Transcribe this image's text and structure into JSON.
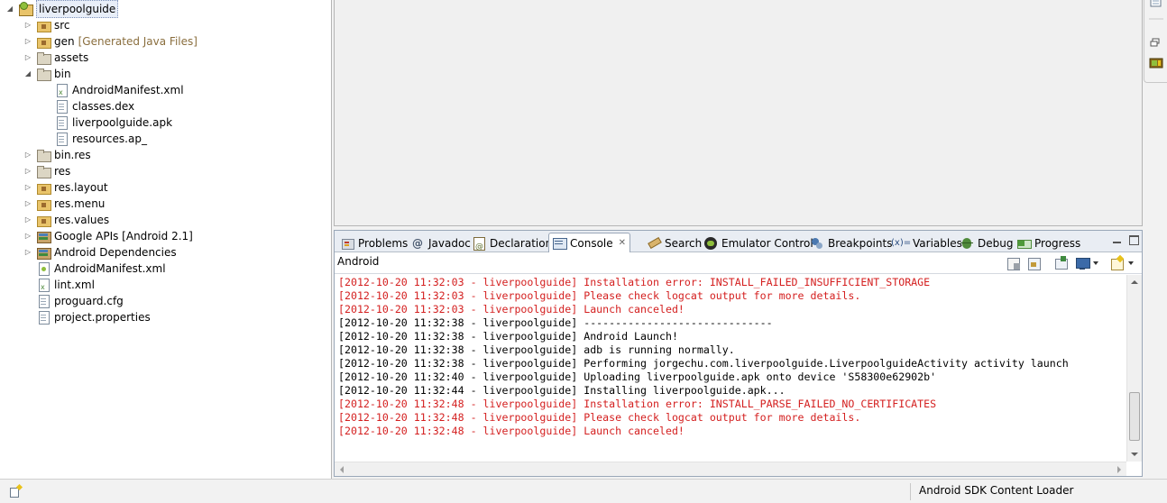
{
  "explorer": {
    "items": [
      {
        "label": "liverpoolguide",
        "decoration": "",
        "icon": "android-project-icon",
        "twisty": "expanded",
        "depth": 0
      },
      {
        "label": "src",
        "decoration": "",
        "icon": "source-folder-icon",
        "twisty": "collapsed",
        "depth": 1
      },
      {
        "label": "gen",
        "decoration": "[Generated Java Files]",
        "icon": "source-folder-icon",
        "twisty": "collapsed",
        "depth": 1
      },
      {
        "label": "assets",
        "decoration": "",
        "icon": "folder-icon",
        "twisty": "collapsed",
        "depth": 1
      },
      {
        "label": "bin",
        "decoration": "",
        "icon": "folder-icon",
        "twisty": "expanded",
        "depth": 1
      },
      {
        "label": "AndroidManifest.xml",
        "decoration": "",
        "icon": "xml-file-icon",
        "twisty": "none",
        "depth": 2
      },
      {
        "label": "classes.dex",
        "decoration": "",
        "icon": "file-icon",
        "twisty": "none",
        "depth": 2
      },
      {
        "label": "liverpoolguide.apk",
        "decoration": "",
        "icon": "file-icon",
        "twisty": "none",
        "depth": 2
      },
      {
        "label": "resources.ap_",
        "decoration": "",
        "icon": "file-icon",
        "twisty": "none",
        "depth": 2
      },
      {
        "label": "bin.res",
        "decoration": "",
        "icon": "folder-icon",
        "twisty": "collapsed",
        "depth": 1
      },
      {
        "label": "res",
        "decoration": "",
        "icon": "folder-icon",
        "twisty": "collapsed",
        "depth": 1
      },
      {
        "label": "res.layout",
        "decoration": "",
        "icon": "package-folder-icon",
        "twisty": "collapsed",
        "depth": 1
      },
      {
        "label": "res.menu",
        "decoration": "",
        "icon": "package-folder-icon",
        "twisty": "collapsed",
        "depth": 1
      },
      {
        "label": "res.values",
        "decoration": "",
        "icon": "package-folder-icon",
        "twisty": "collapsed",
        "depth": 1
      },
      {
        "label": "Google APIs [Android 2.1]",
        "decoration": "",
        "icon": "library-icon",
        "twisty": "collapsed",
        "depth": 1
      },
      {
        "label": "Android Dependencies",
        "decoration": "",
        "icon": "library-icon",
        "twisty": "collapsed",
        "depth": 1
      },
      {
        "label": "AndroidManifest.xml",
        "decoration": "",
        "icon": "android-manifest-icon",
        "twisty": "none",
        "depth": 1
      },
      {
        "label": "lint.xml",
        "decoration": "",
        "icon": "xml-file-icon",
        "twisty": "none",
        "depth": 1
      },
      {
        "label": "proguard.cfg",
        "decoration": "",
        "icon": "file-icon",
        "twisty": "none",
        "depth": 1
      },
      {
        "label": "project.properties",
        "decoration": "",
        "icon": "file-icon",
        "twisty": "none",
        "depth": 1
      }
    ]
  },
  "panel": {
    "tabs": [
      {
        "label": "Problems",
        "icon": "problems-icon",
        "active": false
      },
      {
        "label": "Javadoc",
        "icon": "javadoc-icon",
        "active": false
      },
      {
        "label": "Declaration",
        "icon": "declaration-icon",
        "active": false
      },
      {
        "label": "Console",
        "icon": "console-icon",
        "active": true
      },
      {
        "label": "Search",
        "icon": "search-icon",
        "active": false
      },
      {
        "label": "Emulator Control",
        "icon": "emulator-icon",
        "active": false
      },
      {
        "label": "Breakpoints",
        "icon": "breakpoints-icon",
        "active": false
      },
      {
        "label": "Variables",
        "icon": "variables-icon",
        "active": false
      },
      {
        "label": "Debug",
        "icon": "debug-icon",
        "active": false
      },
      {
        "label": "Progress",
        "icon": "progress-icon",
        "active": false
      }
    ],
    "variables_glyph": "(x)=",
    "javadoc_glyph": "@",
    "console_title": "Android",
    "console_lines": [
      {
        "text": "[2012-10-20 11:32:03 - liverpoolguide] Installation error: INSTALL_FAILED_INSUFFICIENT_STORAGE",
        "level": "error"
      },
      {
        "text": "[2012-10-20 11:32:03 - liverpoolguide] Please check logcat output for more details.",
        "level": "error"
      },
      {
        "text": "[2012-10-20 11:32:03 - liverpoolguide] Launch canceled!",
        "level": "error"
      },
      {
        "text": "[2012-10-20 11:32:38 - liverpoolguide] ------------------------------",
        "level": "info"
      },
      {
        "text": "[2012-10-20 11:32:38 - liverpoolguide] Android Launch!",
        "level": "info"
      },
      {
        "text": "[2012-10-20 11:32:38 - liverpoolguide] adb is running normally.",
        "level": "info"
      },
      {
        "text": "[2012-10-20 11:32:38 - liverpoolguide] Performing jorgechu.com.liverpoolguide.LiverpoolguideActivity activity launch",
        "level": "info"
      },
      {
        "text": "[2012-10-20 11:32:40 - liverpoolguide] Uploading liverpoolguide.apk onto device 'S58300e62902b'",
        "level": "info"
      },
      {
        "text": "[2012-10-20 11:32:44 - liverpoolguide] Installing liverpoolguide.apk...",
        "level": "info"
      },
      {
        "text": "[2012-10-20 11:32:48 - liverpoolguide] Installation error: INSTALL_PARSE_FAILED_NO_CERTIFICATES",
        "level": "error"
      },
      {
        "text": "[2012-10-20 11:32:48 - liverpoolguide] Please check logcat output for more details.",
        "level": "error"
      },
      {
        "text": "[2012-10-20 11:32:48 - liverpoolguide] Launch canceled!",
        "level": "error"
      }
    ]
  },
  "statusbar": {
    "text": "Android SDK Content Loader"
  },
  "colors": {
    "error_text": "#d42020",
    "decoration_text": "#8a6e3e",
    "panel_border": "#9aa7b8"
  }
}
